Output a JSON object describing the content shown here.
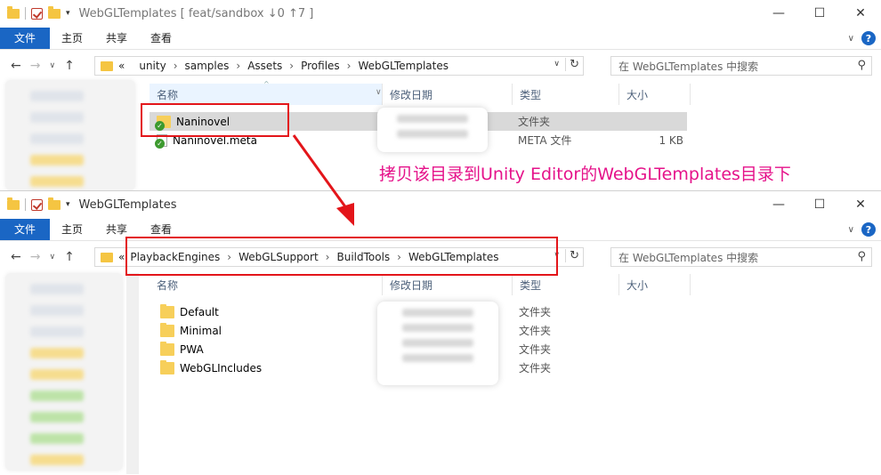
{
  "top_window": {
    "title": "WebGLTemplates [ feat/sandbox ↓0 ↑7 ]",
    "ribbon": {
      "file": "文件",
      "home": "主页",
      "share": "共享",
      "view": "查看"
    },
    "breadcrumb": [
      "unity",
      "samples",
      "Assets",
      "Profiles",
      "WebGLTemplates"
    ],
    "breadcrumb_prefix": "«",
    "search_placeholder": "在 WebGLTemplates 中搜索",
    "columns": {
      "name": "名称",
      "date": "修改日期",
      "type": "类型",
      "size": "大小"
    },
    "files": [
      {
        "name": "Naninovel",
        "type": "文件夹",
        "size": "",
        "icon": "folder-git-icon"
      },
      {
        "name": "Naninovel.meta",
        "type": "META 文件",
        "size": "1 KB",
        "icon": "file-git-icon"
      }
    ]
  },
  "annotation_text": "拷贝该目录到Unity Editor的WebGLTemplates目录下",
  "bottom_window": {
    "title": "WebGLTemplates",
    "ribbon": {
      "file": "文件",
      "home": "主页",
      "share": "共享",
      "view": "查看"
    },
    "breadcrumb": [
      "PlaybackEngines",
      "WebGLSupport",
      "BuildTools",
      "WebGLTemplates"
    ],
    "breadcrumb_prefix": "«",
    "search_placeholder": "在 WebGLTemplates 中搜索",
    "columns": {
      "name": "名称",
      "date": "修改日期",
      "type": "类型",
      "size": "大小"
    },
    "files": [
      {
        "name": "Default",
        "type": "文件夹"
      },
      {
        "name": "Minimal",
        "type": "文件夹"
      },
      {
        "name": "PWA",
        "type": "文件夹"
      },
      {
        "name": "WebGLIncludes",
        "type": "文件夹"
      }
    ]
  },
  "colors": {
    "accent": "#1a66c4",
    "highlight_red": "#e3151a",
    "annotation_pink": "#e5128a",
    "folder": "#f7cf5a"
  }
}
